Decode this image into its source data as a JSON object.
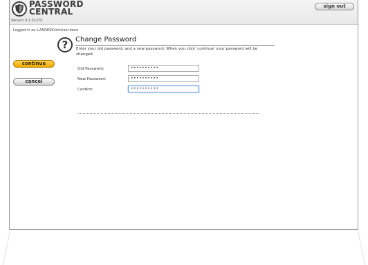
{
  "app": {
    "logo_line1": "PASSWORD",
    "logo_line2": "CENTRAL",
    "version": "Version 9.1.01270"
  },
  "header": {
    "signout_label": "sign out"
  },
  "session": {
    "logged_in_text": "Logged in as: LANDESK\\michael.dene"
  },
  "main": {
    "title": "Change Password",
    "description": "Enter your old password, and a new password. When you click 'continue' your password will be changed.",
    "fields": [
      {
        "label": "Old Password:",
        "value": "••••••••••"
      },
      {
        "label": "New Password:",
        "value": "••••••••••"
      },
      {
        "label": "Confirm",
        "value": "••••••••••"
      }
    ]
  },
  "actions": {
    "continue_label": "continue",
    "cancel_label": "cancel"
  },
  "colors": {
    "continue_accent": "#f0a900",
    "frame_border": "#9a9a9a"
  }
}
